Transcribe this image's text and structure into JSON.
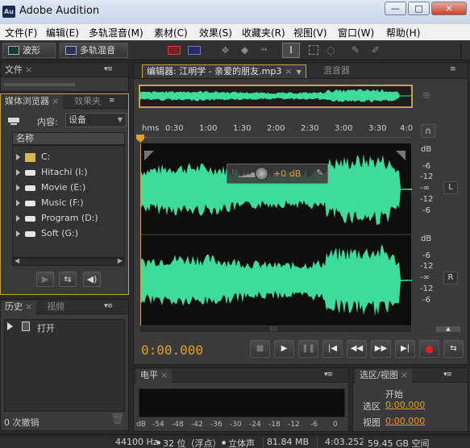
{
  "window": {
    "app_icon": "Au",
    "title": "Adobe Audition",
    "min": "—",
    "max": "□",
    "close": "✕"
  },
  "menu": [
    "文件(F)",
    "编辑(E)",
    "多轨混音(M)",
    "素材(C)",
    "效果(S)",
    "收藏夹(R)",
    "视图(V)",
    "窗口(W)",
    "帮助(H)"
  ],
  "toolbar": {
    "waveform": "波形",
    "multitrack": "多轨混音"
  },
  "files_panel": {
    "tab": "文件",
    "close": "×"
  },
  "browser_panel": {
    "tab_active": "媒体浏览器",
    "tab_inactive": "效果夹",
    "close": "×",
    "content_label": "内容:",
    "content_value": "设备",
    "col_name": "名称",
    "items": [
      "C:",
      "Hitachi (I:)",
      "Movie (E:)",
      "Music (F:)",
      "Program (D:)",
      "Soft (G:)"
    ]
  },
  "history_panel": {
    "tab_active": "历史",
    "tab_inactive": "视频",
    "close": "×",
    "item": "打开",
    "footer": "0 次撤销"
  },
  "editor": {
    "tab": "编辑器: 江明学 - 亲爱的朋友.mp3",
    "close": "×",
    "mixer_tab": "混音器",
    "ruler": [
      "hms",
      "0:30",
      "1:00",
      "1:30",
      "2:00",
      "2:30",
      "3:00",
      "3:30",
      "4:0"
    ],
    "db_scale": [
      "dB",
      "-6",
      "-12",
      "-∞",
      "-12",
      "-6"
    ],
    "channels": [
      "L",
      "R"
    ],
    "hud_value": "+0 dB",
    "time": "0:00.000"
  },
  "levels_panel": {
    "tab": "电平",
    "close": "×",
    "scale": [
      "dB",
      "-54",
      "-48",
      "-42",
      "-36",
      "-30",
      "-24",
      "-18",
      "-12",
      "-6",
      "0"
    ]
  },
  "selection_panel": {
    "tab": "选区/视图",
    "close": "×",
    "start_label": "开始",
    "sel_label": "选区",
    "sel_value": "0:00.000",
    "view_label": "视图",
    "view_value": "0:00.000"
  },
  "status": {
    "sample_rate": "44100 Hz",
    "bit_depth": "32 位（浮点）",
    "channels": "立体声",
    "size": "81.84 MB",
    "duration": "4:03.252",
    "free": "59.45 GB 空间"
  },
  "colors": {
    "accent": "#c6a244",
    "waveform": "#3ddc9a",
    "time": "#e0a020"
  }
}
